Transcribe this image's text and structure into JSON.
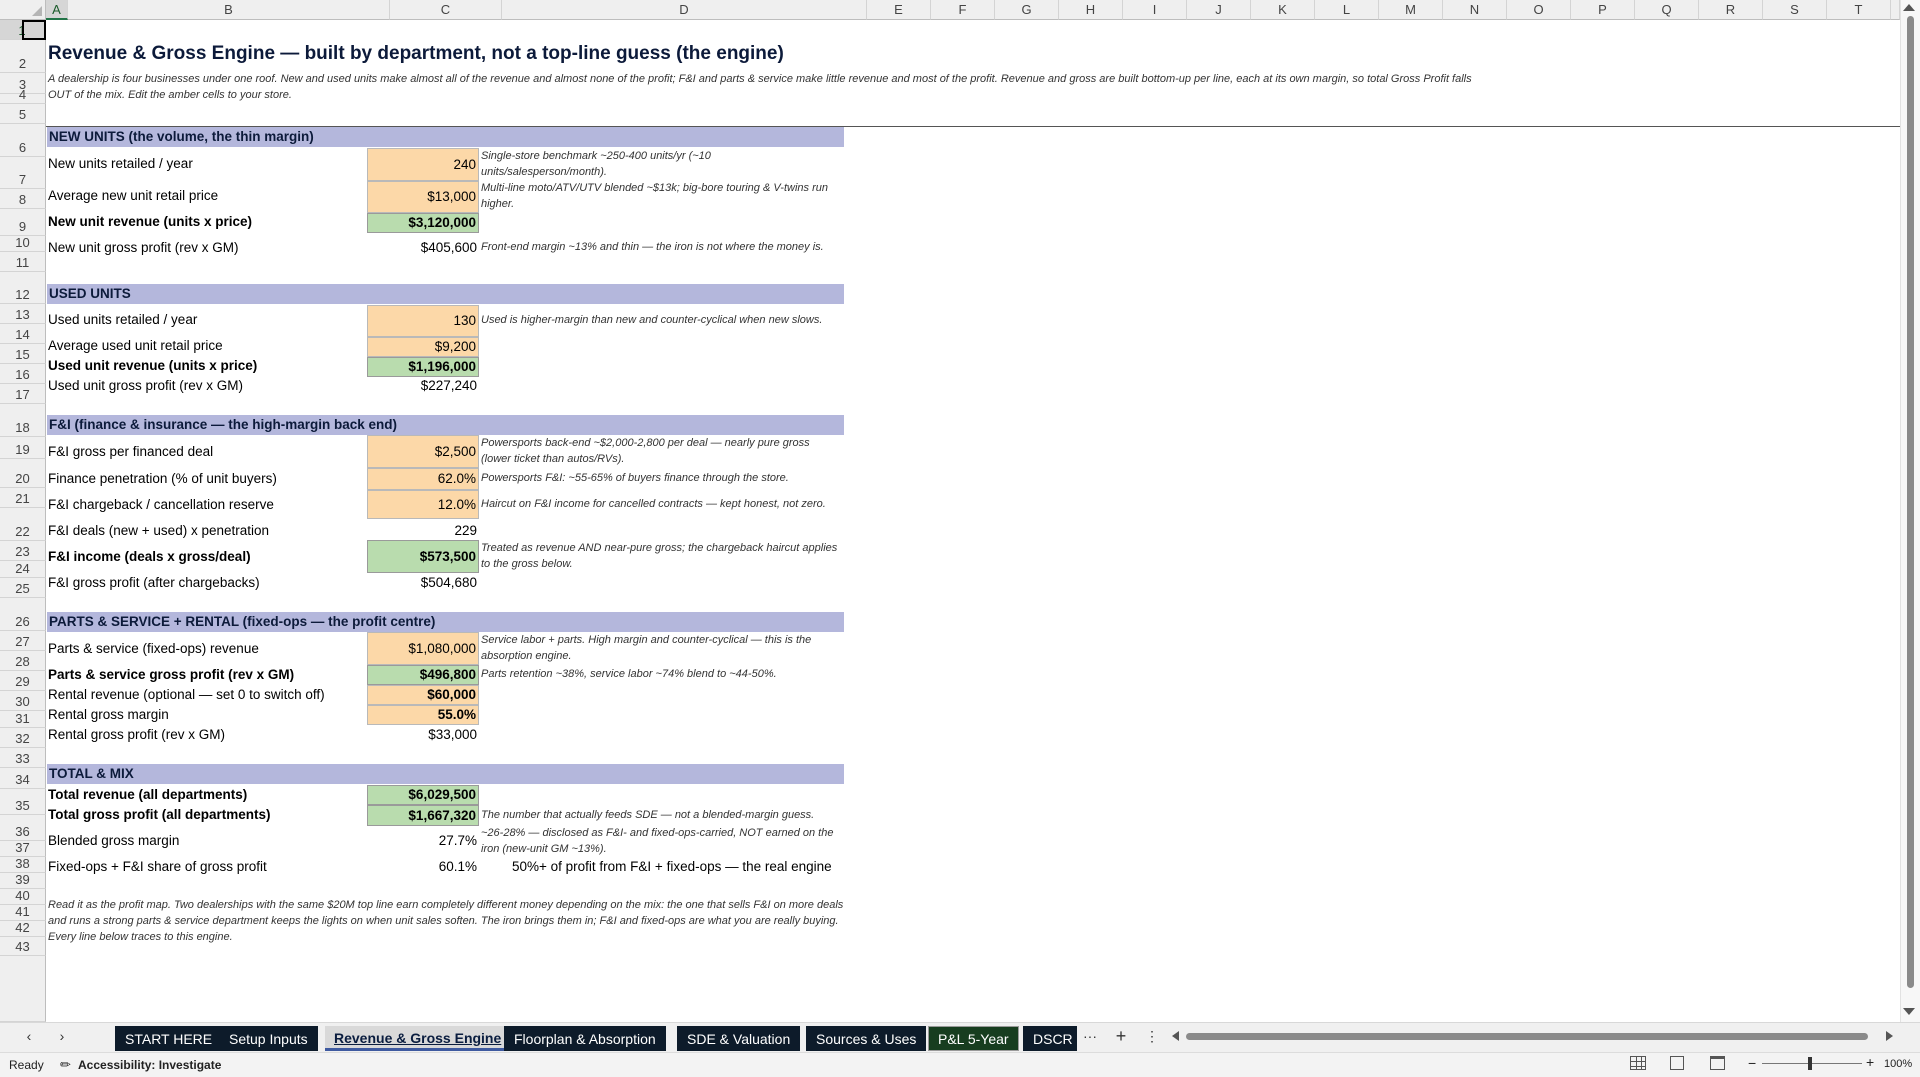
{
  "grid": {
    "columns": [
      "A",
      "B",
      "C",
      "D",
      "E",
      "F",
      "G",
      "H",
      "I",
      "J",
      "K",
      "L",
      "M",
      "N",
      "O",
      "P",
      "Q",
      "R",
      "S",
      "T"
    ],
    "rows": [
      "1",
      "2",
      "3",
      "4",
      "5",
      "6",
      "7",
      "8",
      "9",
      "10",
      "11",
      "12",
      "13",
      "14",
      "15",
      "16",
      "17",
      "18",
      "19",
      "20",
      "21",
      "22",
      "23",
      "24",
      "25",
      "26",
      "27",
      "28",
      "29",
      "30",
      "31",
      "32",
      "33",
      "34",
      "35",
      "36",
      "37",
      "38",
      "39",
      "40",
      "41",
      "42",
      "43"
    ]
  },
  "title": "Revenue & Gross Engine — built by department, not a top-line guess (the engine)",
  "intro": "A dealership is four businesses under one roof. New and used units make almost all of the revenue and almost none of the profit; F&I and parts & service make little revenue and most of the profit. Revenue and gross are built bottom-up per line, each at its own margin, so total Gross Profit falls OUT of the mix. Edit the amber cells to your store.",
  "sections": {
    "new_units": "NEW UNITS  (the volume, the thin margin)",
    "used_units": "USED UNITS",
    "fi": "F&I  (finance & insurance — the high-margin back end)",
    "parts": "PARTS & SERVICE + RENTAL  (fixed-ops — the profit centre)",
    "total": "TOTAL & MIX"
  },
  "rows": {
    "r6": {
      "label": "New units retailed / year",
      "value": "240",
      "note": "Single-store benchmark ~250-400 units/yr (~10 units/salesperson/month)."
    },
    "r7": {
      "label": "Average new unit retail price",
      "value": "$13,000",
      "note": "Multi-line moto/ATV/UTV blended ~$13k; big-bore touring & V-twins run higher."
    },
    "r8": {
      "label": "New unit revenue (units x price)",
      "value": "$3,120,000"
    },
    "r9": {
      "label": "New unit gross profit (rev x GM)",
      "value": "$405,600",
      "note": "Front-end margin ~13% and thin — the iron is not where the money is."
    },
    "r12": {
      "label": "Used units retailed / year",
      "value": "130",
      "note": "Used is higher-margin than new and counter-cyclical when new slows."
    },
    "r13": {
      "label": "Average used unit retail price",
      "value": "$9,200"
    },
    "r14": {
      "label": "Used unit revenue (units x price)",
      "value": "$1,196,000"
    },
    "r15": {
      "label": "Used unit gross profit (rev x GM)",
      "value": "$227,240"
    },
    "r18": {
      "label": "F&I gross per financed deal",
      "value": "$2,500",
      "note": "Powersports back-end ~$2,000-2,800 per deal — nearly pure gross (lower ticket than autos/RVs)."
    },
    "r19": {
      "label": "Finance penetration (% of unit buyers)",
      "value": "62.0%",
      "note": "Powersports F&I: ~55-65% of buyers finance through the store."
    },
    "r20": {
      "label": "F&I chargeback / cancellation reserve",
      "value": "12.0%",
      "note": "Haircut on F&I income for cancelled contracts — kept honest, not zero."
    },
    "r21": {
      "label": "F&I deals (new + used) x penetration",
      "value": "229"
    },
    "r22": {
      "label": "F&I income (deals x gross/deal)",
      "value": "$573,500",
      "note": "Treated as revenue AND near-pure gross; the chargeback haircut applies to the gross below."
    },
    "r23": {
      "label": "F&I gross profit (after chargebacks)",
      "value": "$504,680"
    },
    "r26": {
      "label": "Parts & service (fixed-ops) revenue",
      "value": "$1,080,000",
      "note": "Service labor + parts. High margin and counter-cyclical — this is the absorption engine."
    },
    "r27": {
      "label": "Parts & service gross profit (rev x GM)",
      "value": "$496,800",
      "note": "Parts retention ~38%, service labor ~74% blend to ~44-50%."
    },
    "r28": {
      "label": "Rental revenue (optional — set 0 to switch off)",
      "value": "$60,000"
    },
    "r29": {
      "label": "Rental gross margin",
      "value": "55.0%"
    },
    "r30": {
      "label": "Rental gross profit (rev x GM)",
      "value": "$33,000"
    },
    "r33": {
      "label": "Total revenue (all departments)",
      "value": "$6,029,500"
    },
    "r34": {
      "label": "Total gross profit (all departments)",
      "value": "$1,667,320",
      "note": "The number that actually feeds SDE — not a blended-margin guess."
    },
    "r35": {
      "label": "Blended gross margin",
      "value": "27.7%",
      "note": "~26-28% — disclosed as F&I- and fixed-ops-carried, NOT earned on the iron (new-unit GM ~13%)."
    },
    "r36": {
      "label": "Fixed-ops + F&I share of gross profit",
      "value": "60.1%",
      "note": "50%+ of profit from F&I + fixed-ops — the real engine"
    }
  },
  "footer_note": "Read it as the profit map. Two dealerships with the same $20M top line earn completely different money depending on the mix: the one that sells F&I on more deals and runs a strong parts & service department keeps the lights on when unit sales soften. The iron brings them in; F&I and fixed-ops are what you are really buying. Every line below traces to this engine.",
  "tabs": {
    "start": "START HERE",
    "setup": "Setup Inputs",
    "revenue": "Revenue & Gross Engine",
    "floorplan": "Floorplan & Absorption",
    "sde": "SDE & Valuation",
    "sources": "Sources & Uses",
    "pl": "P&L 5-Year",
    "dscr": "DSCR &",
    "more": "···",
    "add": "+",
    "menu": "⋮"
  },
  "status": {
    "ready": "Ready",
    "accessibility": "Accessibility: Investigate",
    "zoom": "100%"
  },
  "colors": {
    "amber": "#fcd8a8",
    "green": "#b9dcae",
    "banner": "#b4b7dc",
    "title_navy": "#0c1a3a"
  }
}
